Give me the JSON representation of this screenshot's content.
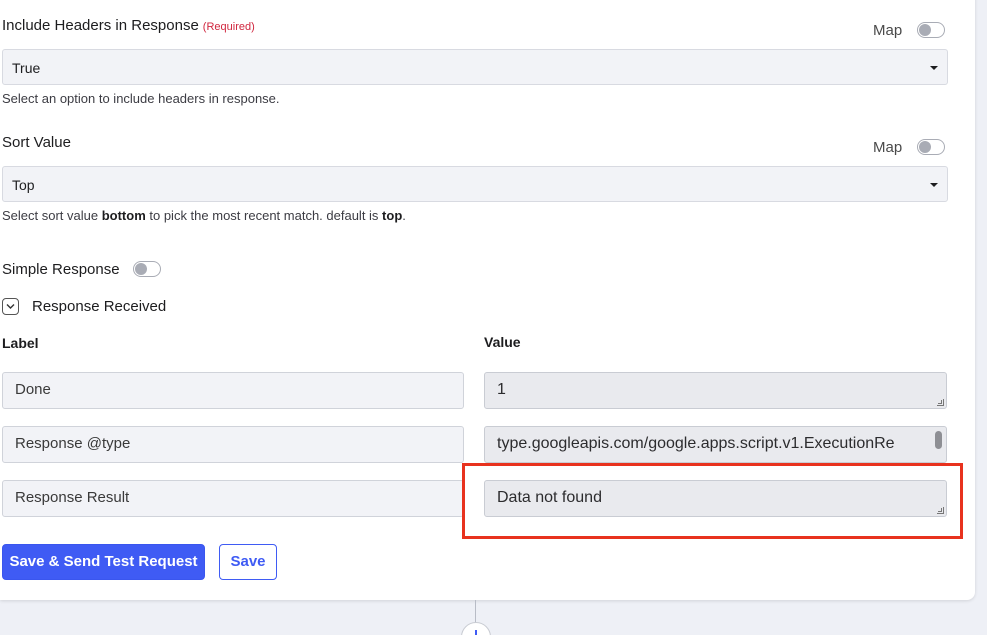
{
  "include_headers": {
    "title": "Include Headers in Response",
    "required": "(Required)",
    "map_label": "Map",
    "selected": "True",
    "help": "Select an option to include headers in response."
  },
  "sort_value": {
    "title": "Sort Value",
    "map_label": "Map",
    "selected": "Top",
    "help_prefix": "Select sort value ",
    "help_bold_1": "bottom",
    "help_middle": " to pick the most recent match. default is ",
    "help_bold_2": "top",
    "help_suffix": "."
  },
  "simple_response": {
    "label": "Simple Response"
  },
  "response_received": {
    "label": "Response Received",
    "columns": {
      "label": "Label",
      "value": "Value"
    },
    "rows": [
      {
        "label": "Done",
        "value": "1"
      },
      {
        "label": "Response @type",
        "value": "type.googleapis.com/google.apps.script.v1.ExecutionRe"
      },
      {
        "label": "Response Result",
        "value": "Data not found"
      }
    ]
  },
  "actions": {
    "save_send": "Save & Send Test Request",
    "save": "Save"
  },
  "colors": {
    "primary": "#3f5bf4",
    "required": "#d0263e",
    "highlight": "#e8321e"
  }
}
